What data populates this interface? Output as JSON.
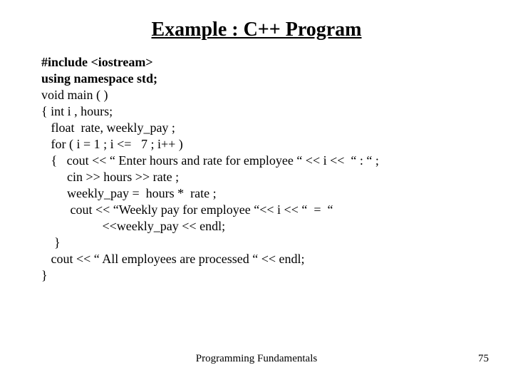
{
  "title": "Example : C++ Program",
  "code": {
    "l01": "#include <iostream>",
    "l02": "using namespace std;",
    "l03": "void main ( )",
    "l04": "{ int i , hours;",
    "l05": "   float  rate, weekly_pay ;",
    "l06": "   for ( i = 1 ; i <=   7 ; i++ )",
    "l07": "   {   cout << “ Enter hours and rate for employee “ << i <<  “ : “ ;",
    "l08": "        cin >> hours >> rate ;",
    "l09": "        weekly_pay =  hours *  rate ;",
    "l10": "         cout << “Weekly pay for employee “<< i << “  =  “",
    "l11": "                   <<weekly_pay << endl;",
    "l12": "    }",
    "l13": "   cout << “ All employees are processed “ << endl;",
    "l14": "}"
  },
  "footer_center": "Programming Fundamentals",
  "footer_page": "75"
}
